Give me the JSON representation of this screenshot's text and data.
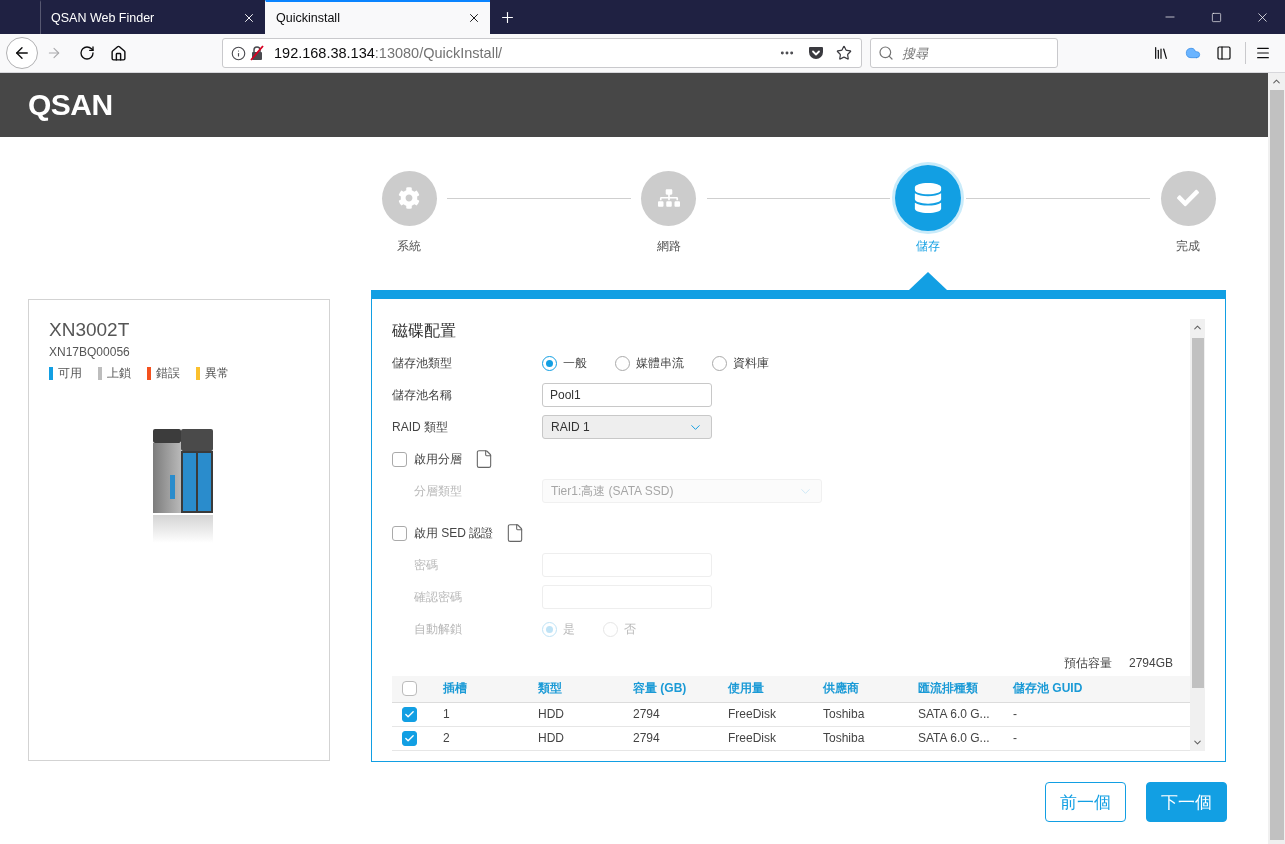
{
  "browser": {
    "tabs": [
      {
        "title": "QSAN Web Finder",
        "selected": false
      },
      {
        "title": "Quickinstall",
        "selected": true
      }
    ],
    "address": {
      "host": "192.168.38.134",
      "path": ":13080/QuickInstall/"
    },
    "search": {
      "placeholder": "搜尋"
    }
  },
  "header": {
    "logo": "QSAN"
  },
  "steps": [
    {
      "label": "系統",
      "selected": false
    },
    {
      "label": "網路",
      "selected": false
    },
    {
      "label": "儲存",
      "selected": true
    },
    {
      "label": "完成",
      "selected": false
    }
  ],
  "device": {
    "model": "XN3002T",
    "serial": "XN17BQ00056",
    "legend": [
      {
        "label": "可用",
        "color": "#129fe3"
      },
      {
        "label": "上鎖",
        "color": "#bdbdbd"
      },
      {
        "label": "錯誤",
        "color": "#f4511e"
      },
      {
        "label": "異常",
        "color": "#fbc02d"
      }
    ]
  },
  "panel": {
    "title": "磁碟配置",
    "fields": [
      {
        "kind": "radio",
        "label": "儲存池類型",
        "disabled": false,
        "options": [
          {
            "label": "一般",
            "selected": true
          },
          {
            "label": "媒體串流",
            "selected": false
          },
          {
            "label": "資料庫",
            "selected": false
          }
        ]
      },
      {
        "kind": "text",
        "label": "儲存池名稱",
        "disabled": false,
        "value": "Pool1"
      },
      {
        "kind": "select",
        "label": "RAID 類型",
        "disabled": false,
        "value": "RAID 1"
      },
      {
        "kind": "checkbox",
        "label": "啟用分層",
        "disabled": false,
        "checked": false,
        "children": [
          {
            "kind": "select",
            "label": "分層類型",
            "disabled": true,
            "value": "Tier1:高速 (SATA SSD)"
          }
        ]
      },
      {
        "kind": "checkbox",
        "label": "啟用 SED 認證",
        "disabled": false,
        "checked": false,
        "children": [
          {
            "kind": "text",
            "label": "密碼",
            "disabled": true
          },
          {
            "kind": "text",
            "label": "確認密碼",
            "disabled": true
          },
          {
            "kind": "radio",
            "label": "自動解鎖",
            "disabled": true,
            "options": [
              {
                "label": "是",
                "selected": true
              },
              {
                "label": "否",
                "selected": false
              }
            ]
          }
        ]
      }
    ],
    "capacity": {
      "label": "預估容量",
      "value": "2794GB"
    },
    "table": {
      "select_all": {
        "checked": false
      },
      "columns": [
        "插槽",
        "類型",
        "容量 (GB)",
        "使用量",
        "供應商",
        "匯流排種類",
        "儲存池 GUID"
      ],
      "rows": [
        {
          "checked": true,
          "cells": [
            "1",
            "HDD",
            "2794",
            "FreeDisk",
            "Toshiba",
            "SATA 6.0 G...",
            "-"
          ]
        },
        {
          "checked": true,
          "cells": [
            "2",
            "HDD",
            "2794",
            "FreeDisk",
            "Toshiba",
            "SATA 6.0 G...",
            "-"
          ]
        }
      ]
    }
  },
  "buttons": [
    {
      "label": "前一個",
      "kind": "secondary"
    },
    {
      "label": "下一個",
      "kind": "primary"
    }
  ]
}
